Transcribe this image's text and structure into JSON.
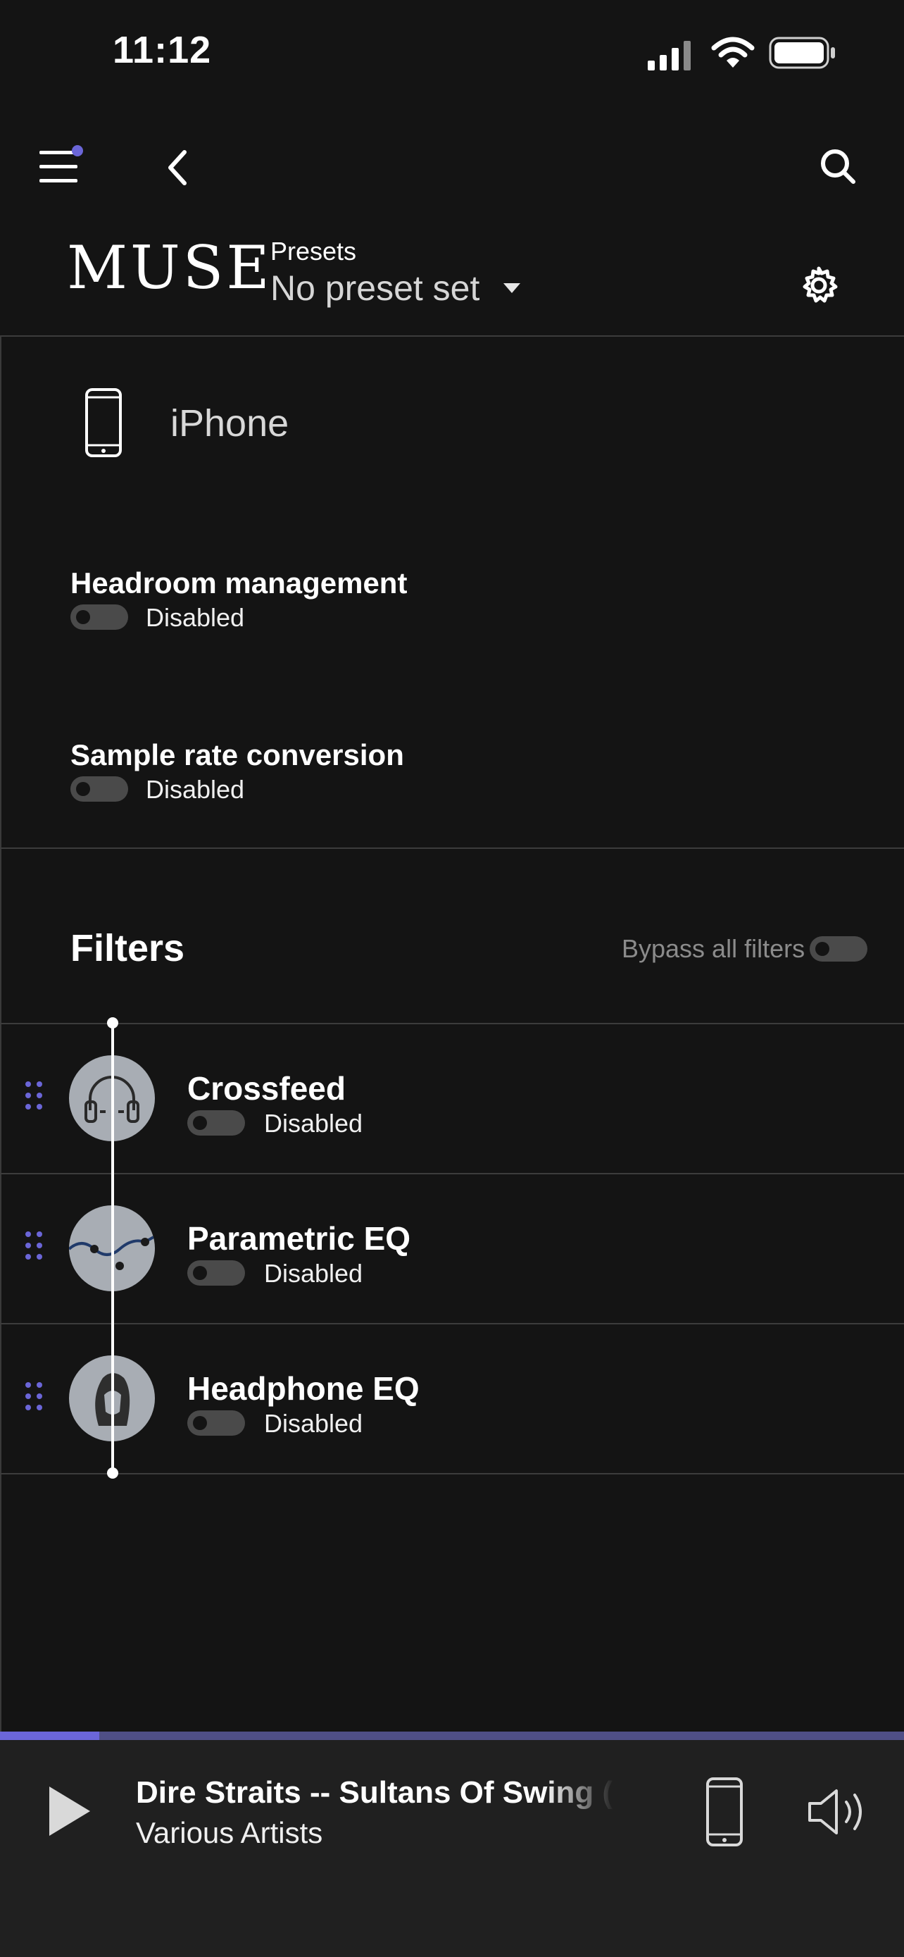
{
  "status_bar": {
    "time": "11:12"
  },
  "header": {
    "brand": "MUSE",
    "presets_label": "Presets",
    "preset_value": "No preset set"
  },
  "device": {
    "name": "iPhone"
  },
  "settings": [
    {
      "title": "Headroom management",
      "state": "Disabled"
    },
    {
      "title": "Sample rate conversion",
      "state": "Disabled"
    }
  ],
  "filters": {
    "title": "Filters",
    "bypass_label": "Bypass all filters",
    "items": [
      {
        "name": "Crossfeed",
        "state": "Disabled"
      },
      {
        "name": "Parametric EQ",
        "state": "Disabled"
      },
      {
        "name": "Headphone EQ",
        "state": "Disabled"
      }
    ]
  },
  "player": {
    "title": "Dire Straits -- Sultans Of Swing (O",
    "artist": "Various Artists",
    "progress_fraction": 0.11
  },
  "colors": {
    "background": "#141414",
    "accent": "#6b66d8",
    "player_bg": "#202020",
    "divider": "#3c3c3c"
  }
}
